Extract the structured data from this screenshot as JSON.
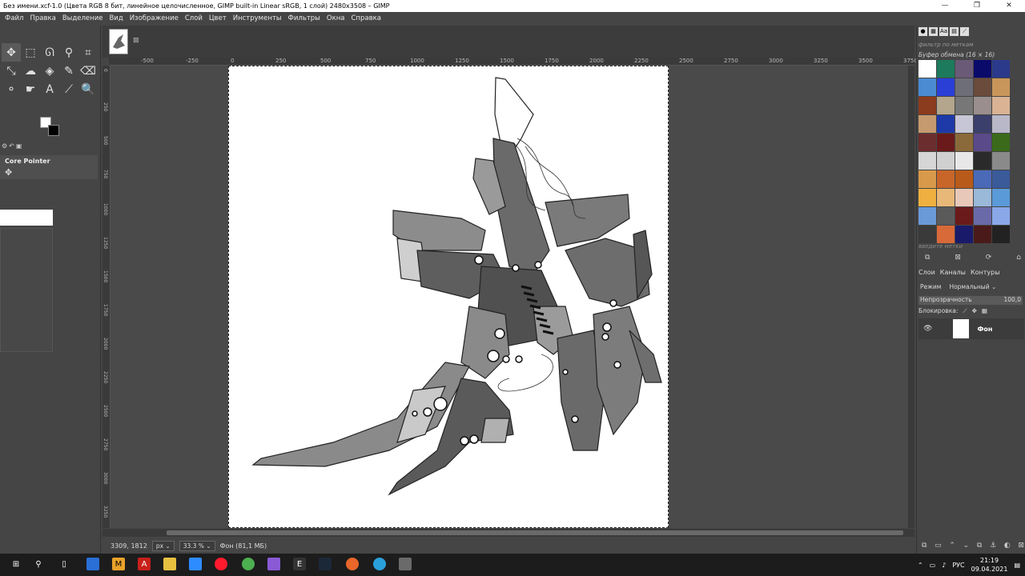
{
  "window": {
    "title": "Без имени.xcf-1.0 (Цвета RGB 8 бит, линейное целочисленное, GIMP built-in Linear sRGB, 1 слой) 2480x3508 – GIMP",
    "minimize": "—",
    "maximize": "❐",
    "close": "✕"
  },
  "menu": [
    "Файл",
    "Правка",
    "Выделение",
    "Вид",
    "Изображение",
    "Слой",
    "Цвет",
    "Инструменты",
    "Фильтры",
    "Окна",
    "Справка"
  ],
  "toolbox": {
    "tools": [
      {
        "name": "move-tool-icon",
        "glyph": "✥",
        "active": true
      },
      {
        "name": "rect-select-icon",
        "glyph": "⬚"
      },
      {
        "name": "lasso-icon",
        "glyph": "ᘏ"
      },
      {
        "name": "fuzzy-select-icon",
        "glyph": "⚲"
      },
      {
        "name": "crop-icon",
        "glyph": "⌗"
      },
      {
        "name": "transform-icon",
        "glyph": "⤡"
      },
      {
        "name": "warp-icon",
        "glyph": "☁"
      },
      {
        "name": "bucket-fill-icon",
        "glyph": "◈"
      },
      {
        "name": "paintbrush-icon",
        "glyph": "✎"
      },
      {
        "name": "eraser-icon",
        "glyph": "⌫"
      },
      {
        "name": "clone-icon",
        "glyph": "⚬"
      },
      {
        "name": "smudge-icon",
        "glyph": "☛"
      },
      {
        "name": "text-tool-icon",
        "glyph": "A"
      },
      {
        "name": "color-picker-icon",
        "glyph": "⟋"
      },
      {
        "name": "zoom-icon",
        "glyph": "🔍"
      }
    ],
    "device_status_title": "Core Pointer"
  },
  "rulers": {
    "top": [
      "-500",
      "-250",
      "0",
      "250",
      "500",
      "750",
      "1000",
      "1250",
      "1500",
      "1750",
      "2000",
      "2250",
      "2500",
      "2750",
      "3000",
      "3250",
      "3500",
      "3750"
    ],
    "left": [
      "0",
      "250",
      "500",
      "750",
      "1000",
      "1250",
      "1500",
      "1750",
      "2000",
      "2250",
      "2500",
      "2750",
      "3000",
      "3250"
    ]
  },
  "status": {
    "coords": "3309, 1812",
    "unit": "px",
    "zoom": "33.3 %",
    "info": "Фон (81,1 МБ)"
  },
  "patterns": {
    "filter_placeholder": "фильтр по меткам",
    "caption": "Буфер обмена (16 × 16)",
    "tags_placeholder": "введите метки",
    "colors": [
      "#ffffff",
      "#1d7a5c",
      "#6b5a77",
      "#0a0a6b",
      "#2b3a8a",
      "#4a8bd1",
      "#2a3fd6",
      "#6e6e78",
      "#6a4b3c",
      "#c9965a",
      "#8b3b1e",
      "#b4a58d",
      "#777777",
      "#9a8e8e",
      "#d9b394",
      "#c69a6f",
      "#1e3aa8",
      "#c6c6d6",
      "#3b3f6b",
      "#b8b8c8",
      "#6b2d2d",
      "#6a1a1a",
      "#8a6a3a",
      "#5a4a8a",
      "#3a6a1a",
      "#d6d6d6",
      "#d0d0d0",
      "#e8e8e8",
      "#2a2a2a",
      "#8a8a8a",
      "#d89a4a",
      "#c8662a",
      "#b85a1a",
      "#4a6ab8",
      "#3a5a9a",
      "#f0b040",
      "#e8b878",
      "#e8c8b8",
      "#9ab8d8",
      "#5a9ad8",
      "#6a9ad8",
      "#5a5a5a",
      "#6a1a1a",
      "#6a6aa8",
      "#8aa8e8",
      "#3a3a3a",
      "#d86a3a",
      "#1a1a6a",
      "#4a1a1a",
      "#222222"
    ]
  },
  "layers": {
    "tabs": [
      "Слои",
      "Каналы",
      "Контуры"
    ],
    "mode_label": "Режим",
    "mode_value": "Нормальный",
    "opacity_label": "Непрозрачность",
    "opacity_value": "100,0",
    "lock_label": "Блокировка:",
    "items": [
      {
        "name": "Фон"
      }
    ]
  },
  "taskbar": {
    "lang": "РУС",
    "time": "21:19",
    "date": "09.04.2021"
  }
}
